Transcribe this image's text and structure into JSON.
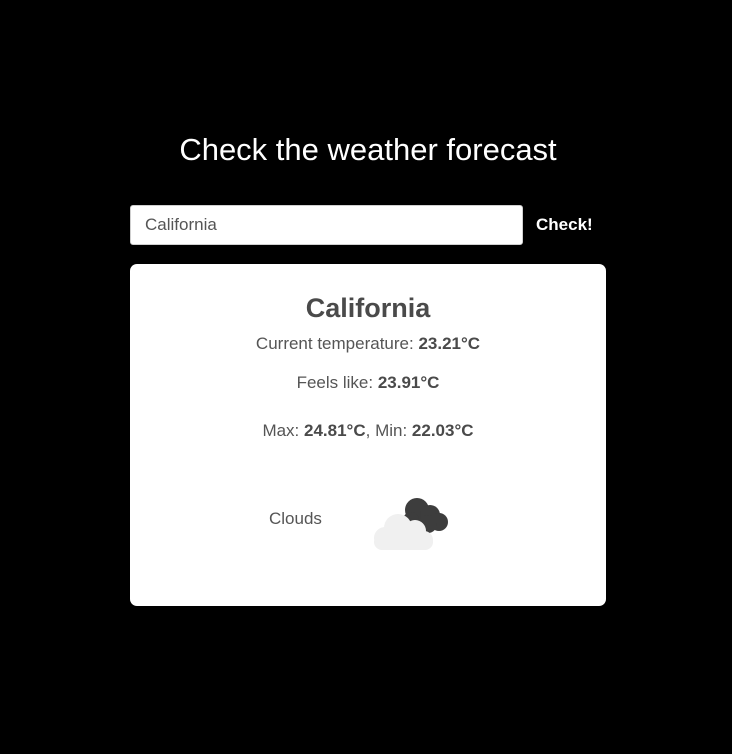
{
  "header": {
    "title": "Check the weather forecast"
  },
  "search": {
    "value": "California",
    "button_label": "Check!"
  },
  "result": {
    "city": "California",
    "current_label": "Current temperature: ",
    "current_value": "23.21°C",
    "feels_label": "Feels like: ",
    "feels_value": "23.91°C",
    "max_label": "Max: ",
    "max_value": "24.81°C",
    "min_label": ", Min: ",
    "min_value": "22.03°C",
    "condition": "Clouds",
    "condition_icon": "clouds-icon"
  },
  "colors": {
    "background": "#000000",
    "card": "#ffffff",
    "text": "#555555"
  }
}
